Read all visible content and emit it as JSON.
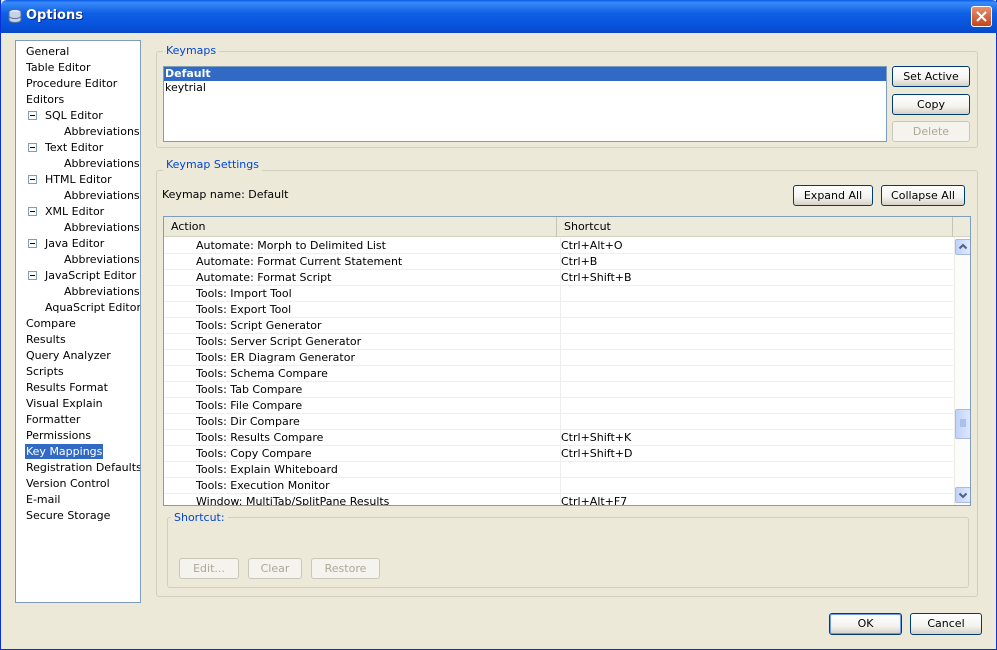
{
  "window": {
    "title": "Options"
  },
  "tree": {
    "items": [
      {
        "label": "General",
        "indent": 0
      },
      {
        "label": "Table Editor",
        "indent": 0
      },
      {
        "label": "Procedure Editor",
        "indent": 0
      },
      {
        "label": "Editors",
        "indent": 0
      },
      {
        "label": "SQL Editor",
        "indent": 1,
        "expander": true
      },
      {
        "label": "Abbreviations",
        "indent": 2
      },
      {
        "label": "Text Editor",
        "indent": 1,
        "expander": true
      },
      {
        "label": "Abbreviations",
        "indent": 2
      },
      {
        "label": "HTML Editor",
        "indent": 1,
        "expander": true
      },
      {
        "label": "Abbreviations",
        "indent": 2
      },
      {
        "label": "XML Editor",
        "indent": 1,
        "expander": true
      },
      {
        "label": "Abbreviations",
        "indent": 2
      },
      {
        "label": "Java Editor",
        "indent": 1,
        "expander": true
      },
      {
        "label": "Abbreviations",
        "indent": 2
      },
      {
        "label": "JavaScript Editor",
        "indent": 1,
        "expander": true
      },
      {
        "label": "Abbreviations",
        "indent": 2
      },
      {
        "label": "AquaScript Editor",
        "indent": 1
      },
      {
        "label": "Compare",
        "indent": 0
      },
      {
        "label": "Results",
        "indent": 0
      },
      {
        "label": "Query Analyzer",
        "indent": 0
      },
      {
        "label": "Scripts",
        "indent": 0
      },
      {
        "label": "Results Format",
        "indent": 0
      },
      {
        "label": "Visual Explain",
        "indent": 0
      },
      {
        "label": "Formatter",
        "indent": 0
      },
      {
        "label": "Permissions",
        "indent": 0
      },
      {
        "label": "Key Mappings",
        "indent": 0,
        "selected": true
      },
      {
        "label": "Registration Defaults",
        "indent": 0
      },
      {
        "label": "Version Control",
        "indent": 0
      },
      {
        "label": "E-mail",
        "indent": 0
      },
      {
        "label": "Secure Storage",
        "indent": 0
      }
    ]
  },
  "keymaps": {
    "group_title": "Keymaps",
    "items": [
      {
        "label": "Default",
        "selected": true
      },
      {
        "label": "keytrial",
        "selected": false
      }
    ],
    "set_active": "Set Active",
    "copy": "Copy",
    "delete": "Delete"
  },
  "settings": {
    "group_title": "Keymap Settings",
    "keymap_name_label": "Keymap name: Default",
    "expand_all": "Expand All",
    "collapse_all": "Collapse All",
    "columns": {
      "action": "Action",
      "shortcut": "Shortcut"
    },
    "rows": [
      {
        "action": "Automate: Morph to Delimited List",
        "shortcut": "Ctrl+Alt+O"
      },
      {
        "action": "Automate: Format Current Statement",
        "shortcut": "Ctrl+B"
      },
      {
        "action": "Automate: Format Script",
        "shortcut": "Ctrl+Shift+B"
      },
      {
        "action": "Tools: Import Tool",
        "shortcut": ""
      },
      {
        "action": "Tools: Export Tool",
        "shortcut": ""
      },
      {
        "action": "Tools: Script Generator",
        "shortcut": ""
      },
      {
        "action": "Tools: Server Script Generator",
        "shortcut": ""
      },
      {
        "action": "Tools: ER Diagram Generator",
        "shortcut": ""
      },
      {
        "action": "Tools: Schema Compare",
        "shortcut": ""
      },
      {
        "action": "Tools: Tab Compare",
        "shortcut": ""
      },
      {
        "action": "Tools: File Compare",
        "shortcut": ""
      },
      {
        "action": "Tools: Dir Compare",
        "shortcut": ""
      },
      {
        "action": "Tools: Results Compare",
        "shortcut": "Ctrl+Shift+K"
      },
      {
        "action": "Tools: Copy Compare",
        "shortcut": "Ctrl+Shift+D"
      },
      {
        "action": "Tools: Explain Whiteboard",
        "shortcut": ""
      },
      {
        "action": "Tools: Execution Monitor",
        "shortcut": ""
      },
      {
        "action": "Window: MultiTab/SplitPane Results",
        "shortcut": "Ctrl+Alt+F7"
      }
    ]
  },
  "shortcut": {
    "group_title": "Shortcut:",
    "edit": "Edit...",
    "clear": "Clear",
    "restore": "Restore"
  },
  "footer": {
    "ok": "OK",
    "cancel": "Cancel"
  },
  "colors": {
    "selection": "#316ac5",
    "group_title": "#0046d5",
    "title_bar": "#0650d8"
  }
}
